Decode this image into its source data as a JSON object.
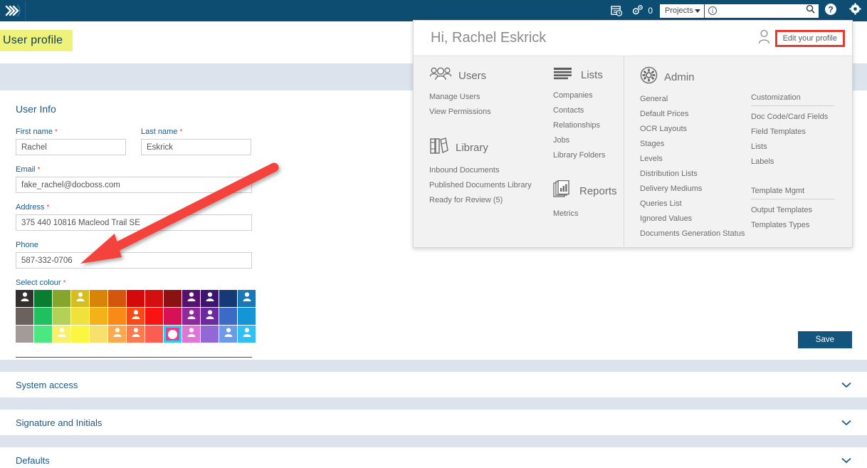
{
  "app": {
    "logo_icon": "triple-chevron-logo",
    "accent_dark": "#0e4d72",
    "accent_link": "#1a5a85",
    "highlight_yellow": "#eef27a",
    "annotation_red": "#ea3a2d"
  },
  "topbar": {
    "report_icon": "report-clock-icon",
    "gears_icon": "gears-icon",
    "gears_count": "0",
    "project_select": {
      "value": "Projects",
      "caret_icon": "chevron-down-icon"
    },
    "search": {
      "info_icon": "info-circle-icon",
      "value": "",
      "placeholder": "",
      "search_icon": "search-icon"
    },
    "help_icon": "help-circle-icon",
    "settings_icon": "gear-icon"
  },
  "page": {
    "title": "User profile"
  },
  "user_info": {
    "section_title": "User Info",
    "fields": {
      "first_name": {
        "label": "First name",
        "required": true,
        "value": "Rachel"
      },
      "last_name": {
        "label": "Last name",
        "required": true,
        "value": "Eskrick"
      },
      "email": {
        "label": "Email",
        "required": true,
        "value": "fake_rachel@docboss.com"
      },
      "address": {
        "label": "Address",
        "required": true,
        "value": "375 440 10816 Macleod Trail SE"
      },
      "phone": {
        "label": "Phone",
        "required": false,
        "value": "587-332-0706"
      }
    },
    "colour": {
      "label": "Select colour",
      "required": true,
      "selected_index": 34,
      "columns": 13,
      "rows": 3,
      "swatches": [
        {
          "hex": "#332f2f",
          "person": true
        },
        {
          "hex": "#0a7d30",
          "person": false
        },
        {
          "hex": "#85a52c",
          "person": false
        },
        {
          "hex": "#d6bd22",
          "person": true
        },
        {
          "hex": "#d98408",
          "person": false
        },
        {
          "hex": "#d4560d",
          "person": false
        },
        {
          "hex": "#d40a0a",
          "person": false
        },
        {
          "hex": "#d30f0f",
          "person": false
        },
        {
          "hex": "#8c1212",
          "person": false
        },
        {
          "hex": "#56116e",
          "person": true
        },
        {
          "hex": "#3d1470",
          "person": true
        },
        {
          "hex": "#173a77",
          "person": false
        },
        {
          "hex": "#1878b8",
          "person": true
        },
        {
          "hex": "#6b625e",
          "person": false
        },
        {
          "hex": "#1ec15e",
          "person": false
        },
        {
          "hex": "#b3d156",
          "person": false
        },
        {
          "hex": "#f0e23c",
          "person": false
        },
        {
          "hex": "#f5b118",
          "person": false
        },
        {
          "hex": "#fa8a18",
          "person": false
        },
        {
          "hex": "#f74a19",
          "person": true
        },
        {
          "hex": "#f91313",
          "person": false
        },
        {
          "hex": "#d61155",
          "person": false
        },
        {
          "hex": "#8e2a9e",
          "person": true
        },
        {
          "hex": "#6c2a9e",
          "person": true
        },
        {
          "hex": "#3b6bc4",
          "person": false
        },
        {
          "hex": "#1495d6",
          "person": false
        },
        {
          "hex": "#a39b97",
          "person": false
        },
        {
          "hex": "#4be882",
          "person": false
        },
        {
          "hex": "#f6f06a",
          "person": true
        },
        {
          "hex": "#fbf63f",
          "person": false
        },
        {
          "hex": "#f7e06d",
          "person": false
        },
        {
          "hex": "#fba94e",
          "person": true
        },
        {
          "hex": "#fb7a4e",
          "person": true
        },
        {
          "hex": "#fb5d52",
          "person": false
        },
        {
          "hex": "#f23a8c",
          "person": false
        },
        {
          "hex": "#e175d6",
          "person": true
        },
        {
          "hex": "#9168d6",
          "person": false
        },
        {
          "hex": "#6b9be8",
          "person": true
        },
        {
          "hex": "#2fc0f5",
          "person": true
        }
      ]
    },
    "save_label": "Save"
  },
  "accordions": [
    {
      "label": "System access",
      "chevron_icon": "chevron-down-icon"
    },
    {
      "label": "Signature and Initials",
      "chevron_icon": "chevron-down-icon"
    },
    {
      "label": "Defaults",
      "chevron_icon": "chevron-down-icon"
    }
  ],
  "panel": {
    "greeting": "Hi, Rachel Eskrick",
    "avatar_icon": "user-outline-icon",
    "edit_profile_label": "Edit your profile",
    "groups": {
      "users": {
        "icon": "users-group-icon",
        "title": "Users",
        "links": [
          "Manage Users",
          "View Permissions"
        ]
      },
      "library": {
        "icon": "books-library-icon",
        "title": "Library",
        "links": [
          "Inbound Documents",
          "Published Documents Library",
          "Ready for Review (5)"
        ]
      },
      "lists": {
        "icon": "list-lines-icon",
        "title": "Lists",
        "links": [
          "Companies",
          "Contacts",
          "Relationships",
          "Jobs",
          "Library Folders"
        ]
      },
      "reports": {
        "icon": "reports-pages-icon",
        "title": "Reports",
        "links": [
          "Metrics"
        ]
      },
      "admin": {
        "icon": "gear-circle-icon",
        "title": "Admin",
        "links": [
          "General",
          "Default Prices",
          "OCR Layouts",
          "Stages",
          "Levels",
          "Distribution Lists",
          "Delivery Mediums",
          "Queries List",
          "Ignored Values",
          "Documents Generation Status"
        ],
        "customization": {
          "heading": "Customization",
          "links": [
            "Doc Code/Card Fields",
            "Field Templates",
            "Lists",
            "Labels"
          ]
        },
        "template_mgmt": {
          "heading": "Template Mgmt",
          "links": [
            "Output Templates",
            "Templates Types"
          ]
        }
      }
    }
  },
  "annotation": {
    "arrow_icon": "red-arrow-annotation",
    "points_to": "Select colour"
  }
}
